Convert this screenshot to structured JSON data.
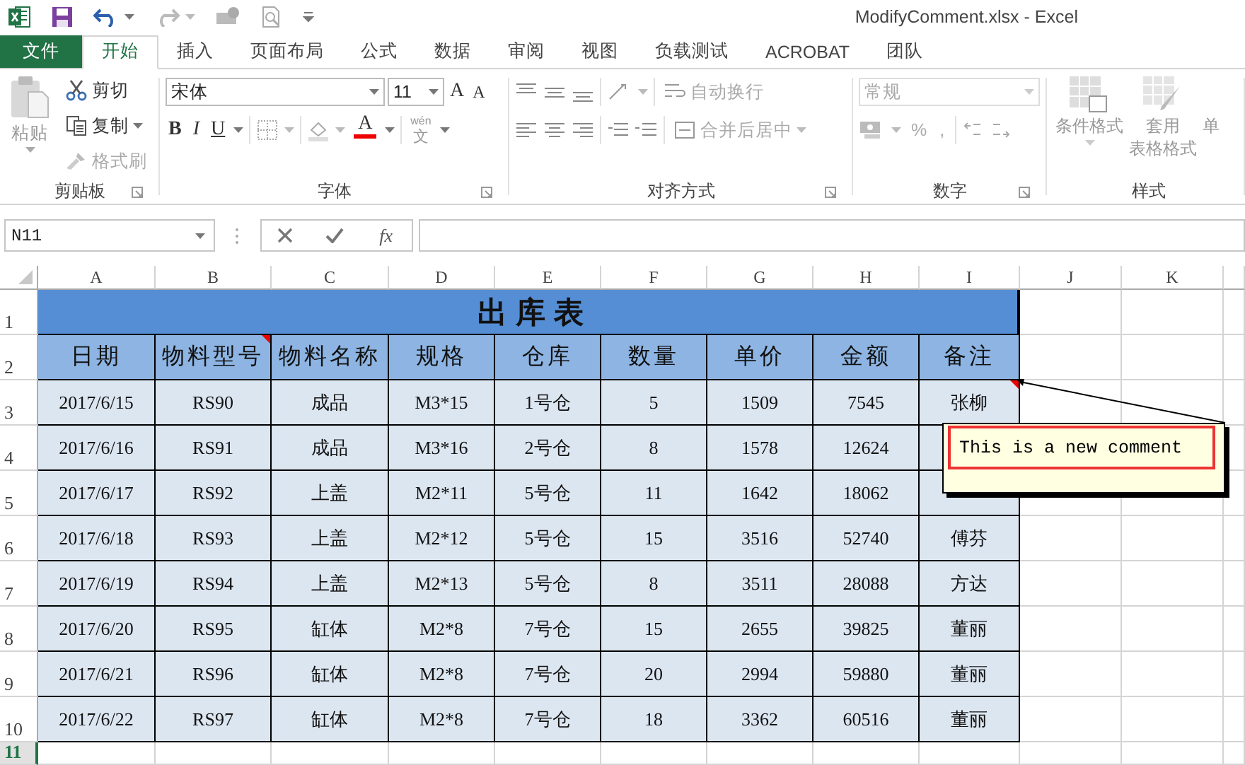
{
  "window": {
    "title": "ModifyComment.xlsx - Excel"
  },
  "tabs": [
    {
      "label": "文件",
      "kind": "file",
      "selected": false
    },
    {
      "label": "开始",
      "kind": "tab",
      "selected": true
    },
    {
      "label": "插入",
      "kind": "tab",
      "selected": false
    },
    {
      "label": "页面布局",
      "kind": "tab",
      "selected": false
    },
    {
      "label": "公式",
      "kind": "tab",
      "selected": false
    },
    {
      "label": "数据",
      "kind": "tab",
      "selected": false
    },
    {
      "label": "审阅",
      "kind": "tab",
      "selected": false
    },
    {
      "label": "视图",
      "kind": "tab",
      "selected": false
    },
    {
      "label": "负载测试",
      "kind": "tab",
      "selected": false
    },
    {
      "label": "ACROBAT",
      "kind": "tab",
      "selected": false
    },
    {
      "label": "团队",
      "kind": "tab",
      "selected": false
    }
  ],
  "ribbon": {
    "clipboard": {
      "label": "剪贴板",
      "paste": {
        "label": "粘贴",
        "disabled": true
      },
      "items": [
        {
          "label": "剪切",
          "disabled": false
        },
        {
          "label": "复制",
          "disabled": false
        },
        {
          "label": "格式刷",
          "disabled": true
        }
      ]
    },
    "font": {
      "label": "字体",
      "font_name": "宋体",
      "font_size": "11",
      "grow": "A",
      "shrink": "A",
      "bold": "B",
      "italic": "I",
      "underline": "U",
      "font_color": "A",
      "phonetic_top": "wén",
      "phonetic_bottom": "文"
    },
    "alignment": {
      "label": "对齐方式",
      "wrap_text": "自动换行",
      "merge_center": "合并后居中"
    },
    "number": {
      "label": "数字",
      "format": "常规",
      "percent": "%",
      "comma": ","
    },
    "styles": {
      "label": "样式",
      "conditional": "条件格式",
      "table_format_1": "套用",
      "table_format_2": "表格格式",
      "cell_styles": "单"
    }
  },
  "formula_bar": {
    "name_box": "N11",
    "fx": "fx"
  },
  "columns": [
    "A",
    "B",
    "C",
    "D",
    "E",
    "F",
    "G",
    "H",
    "I",
    "J",
    "K"
  ],
  "row_headers": [
    {
      "label": "1",
      "selected": false
    },
    {
      "label": "2",
      "selected": false
    },
    {
      "label": "3",
      "selected": false
    },
    {
      "label": "4",
      "selected": false
    },
    {
      "label": "5",
      "selected": false
    },
    {
      "label": "6",
      "selected": false
    },
    {
      "label": "7",
      "selected": false
    },
    {
      "label": "8",
      "selected": false
    },
    {
      "label": "9",
      "selected": false
    },
    {
      "label": "10",
      "selected": false
    },
    {
      "label": "11",
      "selected": true
    }
  ],
  "table": {
    "title": "出库表",
    "header": [
      {
        "text": "日期",
        "comment": false
      },
      {
        "text": "物料型号",
        "comment": true
      },
      {
        "text": "物料名称",
        "comment": false
      },
      {
        "text": "规格",
        "comment": false
      },
      {
        "text": "仓库",
        "comment": false
      },
      {
        "text": "数量",
        "comment": false
      },
      {
        "text": "单价",
        "comment": false
      },
      {
        "text": "金额",
        "comment": false
      },
      {
        "text": "备注",
        "comment": false
      }
    ],
    "rows": [
      {
        "date": "2017/6/15",
        "model": "RS90",
        "name": "成品",
        "spec": "M3*15",
        "warehouse": "1号仓",
        "qty": "5",
        "price": "1509",
        "amount": "7545",
        "remark": "张柳",
        "remark_comment": true
      },
      {
        "date": "2017/6/16",
        "model": "RS91",
        "name": "成品",
        "spec": "M3*16",
        "warehouse": "2号仓",
        "qty": "8",
        "price": "1578",
        "amount": "12624"
      },
      {
        "date": "2017/6/17",
        "model": "RS92",
        "name": "上盖",
        "spec": "M2*11",
        "warehouse": "5号仓",
        "qty": "11",
        "price": "1642",
        "amount": "18062"
      },
      {
        "date": "2017/6/18",
        "model": "RS93",
        "name": "上盖",
        "spec": "M2*12",
        "warehouse": "5号仓",
        "qty": "15",
        "price": "3516",
        "amount": "52740",
        "remark": "傅芬",
        "remark_comment": false
      },
      {
        "date": "2017/6/19",
        "model": "RS94",
        "name": "上盖",
        "spec": "M2*13",
        "warehouse": "5号仓",
        "qty": "8",
        "price": "3511",
        "amount": "28088",
        "remark": "方达",
        "remark_comment": false
      },
      {
        "date": "2017/6/20",
        "model": "RS95",
        "name": "缸体",
        "spec": "M2*8",
        "warehouse": "7号仓",
        "qty": "15",
        "price": "2655",
        "amount": "39825",
        "remark": "董丽",
        "remark_comment": false
      },
      {
        "date": "2017/6/21",
        "model": "RS96",
        "name": "缸体",
        "spec": "M2*8",
        "warehouse": "7号仓",
        "qty": "20",
        "price": "2994",
        "amount": "59880",
        "remark": "董丽",
        "remark_comment": false
      },
      {
        "date": "2017/6/22",
        "model": "RS97",
        "name": "缸体",
        "spec": "M2*8",
        "warehouse": "7号仓",
        "qty": "18",
        "price": "3362",
        "amount": "60516",
        "remark": "董丽",
        "remark_comment": false
      }
    ]
  },
  "comment": {
    "text": "This is a new comment"
  }
}
